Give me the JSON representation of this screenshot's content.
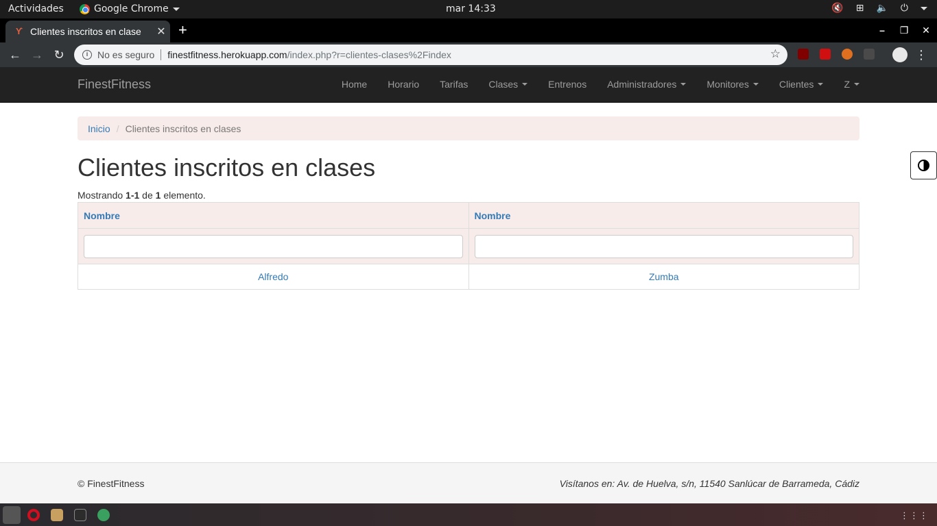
{
  "system": {
    "activities": "Actividades",
    "app_name": "Google Chrome",
    "clock": "mar 14:33"
  },
  "browser": {
    "tab_title": "Clientes inscritos en clase",
    "not_secure": "No es seguro",
    "url_host": "finestfitness.herokuapp.com",
    "url_path": "/index.php?r=clientes-clases%2Findex"
  },
  "navbar": {
    "brand": "FinestFitness",
    "items": [
      {
        "label": "Home",
        "dropdown": false
      },
      {
        "label": "Horario",
        "dropdown": false
      },
      {
        "label": "Tarifas",
        "dropdown": false
      },
      {
        "label": "Clases",
        "dropdown": true
      },
      {
        "label": "Entrenos",
        "dropdown": false
      },
      {
        "label": "Administradores",
        "dropdown": true
      },
      {
        "label": "Monitores",
        "dropdown": true
      },
      {
        "label": "Clientes",
        "dropdown": true
      },
      {
        "label": "Z",
        "dropdown": true
      }
    ]
  },
  "breadcrumb": {
    "home": "Inicio",
    "current": "Clientes inscritos en clases"
  },
  "page": {
    "title": "Clientes inscritos en clases",
    "summary_prefix": "Mostrando ",
    "summary_range": "1-1",
    "summary_mid": " de ",
    "summary_total": "1",
    "summary_suffix": " elemento."
  },
  "table": {
    "headers": [
      "Nombre",
      "Nombre"
    ],
    "rows": [
      [
        "Alfredo",
        "Zumba"
      ]
    ]
  },
  "footer": {
    "copyright": "© FinestFitness",
    "address": "Visítanos en: Av. de Huelva, s/n, 11540 Sanlúcar de Barrameda, Cádiz"
  },
  "colors": {
    "link": "#337ab7",
    "navbar_bg": "#222222",
    "breadcrumb_bg": "#f8ecea"
  }
}
